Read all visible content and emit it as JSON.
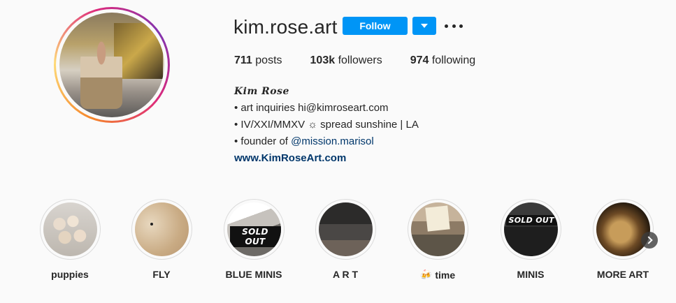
{
  "profile": {
    "username": "kim.rose.art",
    "follow_label": "Follow",
    "stats": {
      "posts_count": "711",
      "posts_label": "posts",
      "followers_count": "103k",
      "followers_label": "followers",
      "following_count": "974",
      "following_label": "following"
    }
  },
  "bio": {
    "full_name": "Kim Rose",
    "line1": "• art inquiries hi@kimroseart.com",
    "line2": "• IV/XXI/MMXV ☼ spread sunshine | LA",
    "line3_prefix": "• founder of ",
    "line3_mention": "@mission.marisol",
    "website": "www.KimRoseArt.com"
  },
  "highlights": [
    {
      "label": "puppies",
      "emoji": ""
    },
    {
      "label": "FLY",
      "emoji": ""
    },
    {
      "label": "BLUE MINIS",
      "emoji": "",
      "tag": "SOLD OUT"
    },
    {
      "label": "A R T",
      "emoji": ""
    },
    {
      "label": "time",
      "emoji": "🍻"
    },
    {
      "label": "MINIS",
      "emoji": "",
      "tag": "SOLD OUT"
    },
    {
      "label": "MORE ART",
      "emoji": ""
    }
  ],
  "icons": {
    "dropdown": "chevron-down-icon",
    "more": "more-horizontal-icon",
    "next": "chevron-right-icon"
  },
  "colors": {
    "follow_button": "#0095f6",
    "link": "#00376b"
  }
}
